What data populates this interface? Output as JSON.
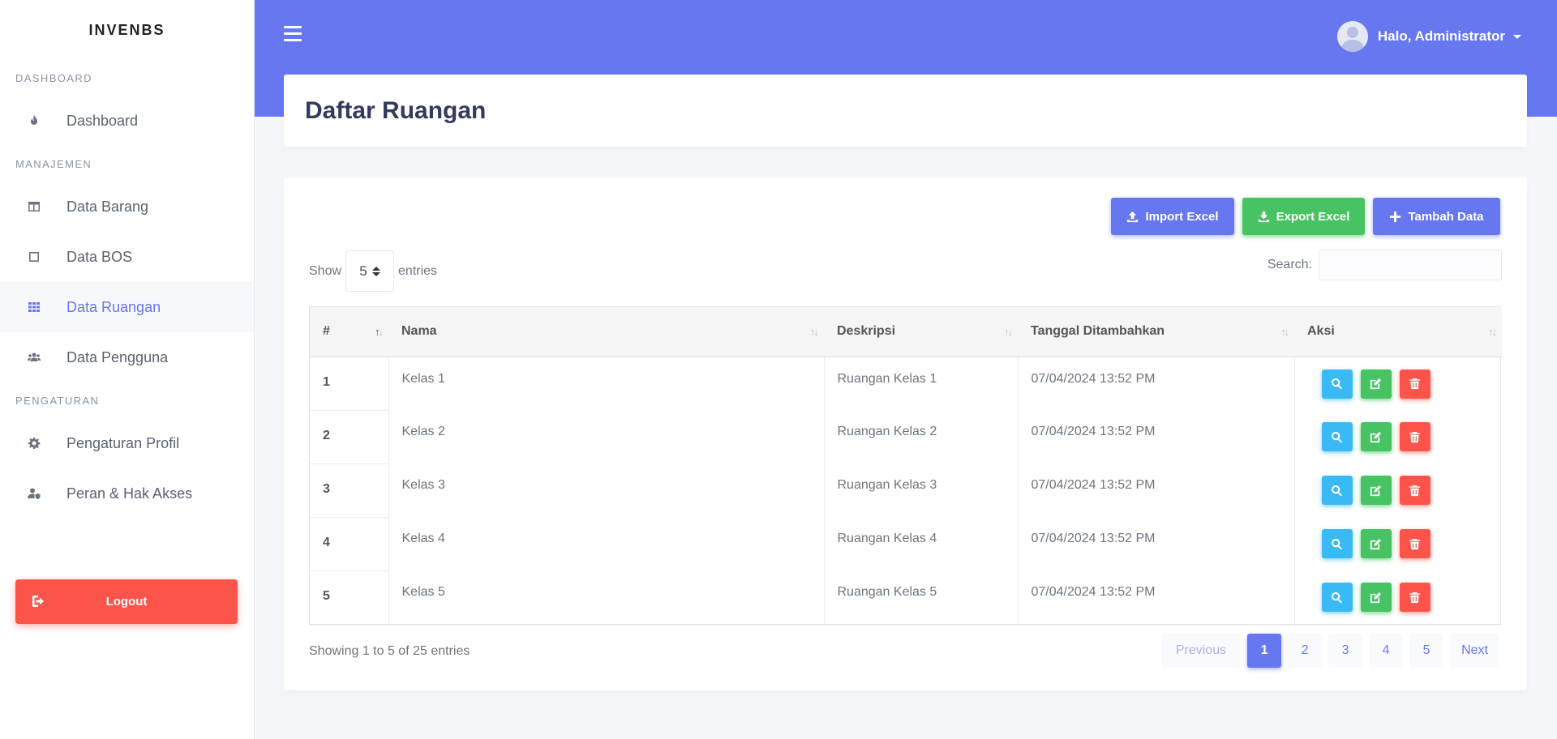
{
  "brand": "INVENBS",
  "sidebar": {
    "sections": [
      {
        "header": "DASHBOARD",
        "items": [
          {
            "label": "Dashboard",
            "icon": "fire-icon"
          }
        ]
      },
      {
        "header": "MANAJEMEN",
        "items": [
          {
            "label": "Data Barang",
            "icon": "table-icon"
          },
          {
            "label": "Data BOS",
            "icon": "square-icon"
          },
          {
            "label": "Data Ruangan",
            "icon": "grid-icon",
            "active": true
          },
          {
            "label": "Data Pengguna",
            "icon": "users-icon"
          }
        ]
      },
      {
        "header": "PENGATURAN",
        "items": [
          {
            "label": "Pengaturan Profil",
            "icon": "gear-icon"
          },
          {
            "label": "Peran & Hak Akses",
            "icon": "user-shield-icon"
          }
        ]
      }
    ],
    "logout_label": "Logout"
  },
  "topbar": {
    "user_greeting": "Halo, Administrator"
  },
  "page": {
    "title": "Daftar Ruangan"
  },
  "toolbar": {
    "import_label": "Import Excel",
    "export_label": "Export Excel",
    "add_label": "Tambah Data"
  },
  "table_controls": {
    "show_label": "Show",
    "entries_value": "5",
    "entries_label": "entries",
    "search_label": "Search:",
    "search_value": ""
  },
  "table": {
    "columns": [
      "#",
      "Nama",
      "Deskripsi",
      "Tanggal Ditambahkan",
      "Aksi"
    ],
    "rows": [
      {
        "num": "1",
        "nama": "Kelas 1",
        "deskripsi": "Ruangan Kelas 1",
        "tanggal": "07/04/2024 13:52 PM"
      },
      {
        "num": "2",
        "nama": "Kelas 2",
        "deskripsi": "Ruangan Kelas 2",
        "tanggal": "07/04/2024 13:52 PM"
      },
      {
        "num": "3",
        "nama": "Kelas 3",
        "deskripsi": "Ruangan Kelas 3",
        "tanggal": "07/04/2024 13:52 PM"
      },
      {
        "num": "4",
        "nama": "Kelas 4",
        "deskripsi": "Ruangan Kelas 4",
        "tanggal": "07/04/2024 13:52 PM"
      },
      {
        "num": "5",
        "nama": "Kelas 5",
        "deskripsi": "Ruangan Kelas 5",
        "tanggal": "07/04/2024 13:52 PM"
      }
    ]
  },
  "footer": {
    "info": "Showing 1 to 5 of 25 entries",
    "pagination": {
      "previous": "Previous",
      "pages": [
        "1",
        "2",
        "3",
        "4",
        "5"
      ],
      "active_page": "1",
      "next": "Next"
    }
  },
  "colors": {
    "primary": "#6777ef",
    "success": "#47c363",
    "info": "#3abaf4",
    "danger": "#fc544b"
  }
}
